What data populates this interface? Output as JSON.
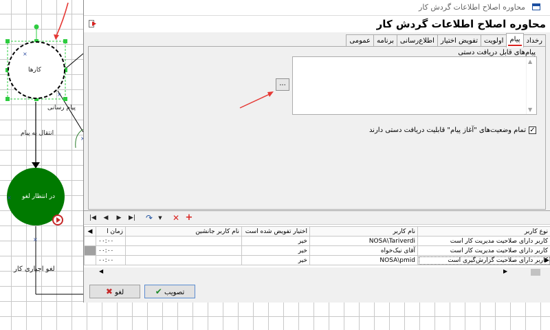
{
  "canvas": {
    "node_1_label": "کارها",
    "node_2_label": "در انتظار لغو",
    "edge_1_label": "پیام رسانی",
    "edge_2_label": "انتقال به پیام",
    "edge_3_label": "لغو اجباری کار",
    "node_1_fill": "#ffffff",
    "node_2_fill": "#007a00",
    "annotation_color": "#e53935"
  },
  "dialog": {
    "window_title": "محاوره اصلاح اطلاعات گردش کار",
    "header_title": "محاوره اصلاح اطلاعات گردش کار",
    "tabs": [
      {
        "label": "رخداد",
        "active": false
      },
      {
        "label": "پیام",
        "active": true
      },
      {
        "label": "اولویت",
        "active": false
      },
      {
        "label": "تفویض اختیار",
        "active": false
      },
      {
        "label": "اطلاع‌رسانی",
        "active": false
      },
      {
        "label": "برنامه",
        "active": false
      },
      {
        "label": "عمومی",
        "active": false
      }
    ],
    "message_panel": {
      "label": "پیام‌های قابل دریافت دستی",
      "browse_label": "...",
      "checkbox_label": "تمام وضعیت‌های \"آغاز پیام\" قابلیت دریافت دستی دارند",
      "checkbox_checked": true,
      "checkbox_mark": "✓"
    },
    "grid": {
      "columns": [
        "زمان ا",
        "نام کاربر جانشین",
        "اختیار تفویض شده است",
        "نام کاربر",
        "نوع کاربر"
      ],
      "rows": [
        {
          "time": "۰۰:۰۰",
          "substitute": "",
          "delegated": "خیر",
          "user": "NOSA\\Tariverdi",
          "type": "کاربر دارای صلاحیت مدیریت کار است"
        },
        {
          "time": "۰۰:۰۰",
          "substitute": "",
          "delegated": "خیر",
          "user": "آقای نیک‌خواه",
          "type": "کاربر دارای صلاحیت مدیریت کار است"
        },
        {
          "time": "۰۰:۰۰",
          "substitute": "",
          "delegated": "خیر",
          "user": "NOSA\\pmid",
          "type": "کاربر دارای صلاحیت گزارش‌گیری است"
        }
      ]
    },
    "ok_label": "تصویب",
    "cancel_label": "لغو"
  }
}
